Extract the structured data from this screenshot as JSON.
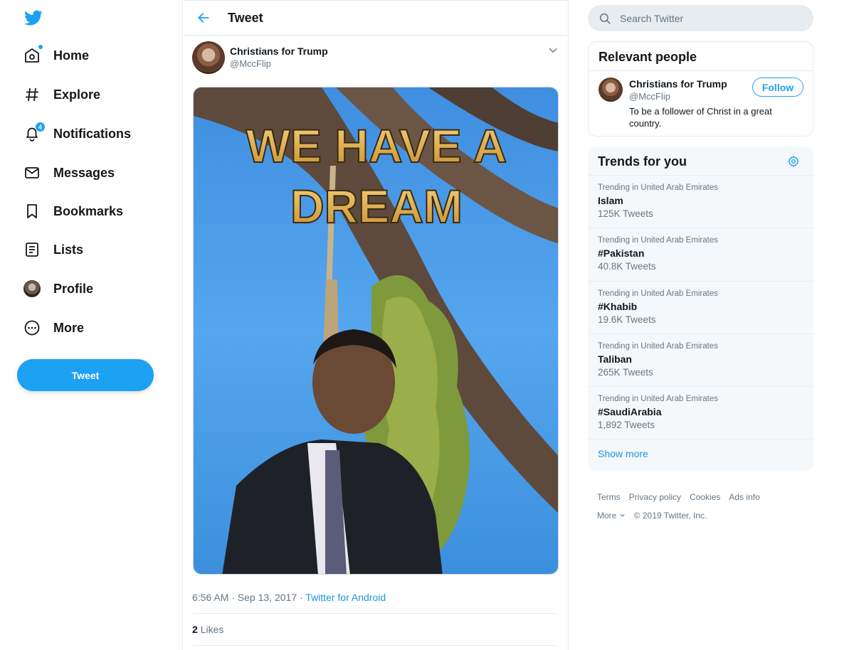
{
  "nav": {
    "items": [
      {
        "label": "Home",
        "icon": "home-icon"
      },
      {
        "label": "Explore",
        "icon": "hashtag-icon"
      },
      {
        "label": "Notifications",
        "icon": "bell-icon",
        "badge": "4"
      },
      {
        "label": "Messages",
        "icon": "envelope-icon"
      },
      {
        "label": "Bookmarks",
        "icon": "bookmark-icon"
      },
      {
        "label": "Lists",
        "icon": "list-icon"
      },
      {
        "label": "Profile",
        "icon": "avatar"
      },
      {
        "label": "More",
        "icon": "more-icon"
      }
    ],
    "tweet_button": "Tweet"
  },
  "tweet": {
    "header_title": "Tweet",
    "author_name": "Christians for Trump",
    "author_handle": "@MccFlip",
    "image_text_line1": "WE HAVE A",
    "image_text_line2": "DREAM",
    "time": "6:56 AM · Sep 13, 2017 · ",
    "via": "Twitter for Android",
    "likes_count": "2",
    "likes_label": "Likes"
  },
  "search": {
    "placeholder": "Search Twitter"
  },
  "relevant": {
    "title": "Relevant people",
    "name": "Christians for Trump",
    "handle": "@MccFlip",
    "bio": "To be a follower of Christ in a great country.",
    "follow_label": "Follow"
  },
  "trends": {
    "title": "Trends for you",
    "items": [
      {
        "context": "Trending in United Arab Emirates",
        "name": "Islam",
        "count": "125K Tweets"
      },
      {
        "context": "Trending in United Arab Emirates",
        "name": "#Pakistan",
        "count": "40.8K Tweets"
      },
      {
        "context": "Trending in United Arab Emirates",
        "name": "#Khabib",
        "count": "19.6K Tweets"
      },
      {
        "context": "Trending in United Arab Emirates",
        "name": "Taliban",
        "count": "265K Tweets"
      },
      {
        "context": "Trending in United Arab Emirates",
        "name": "#SaudiArabia",
        "count": "1,892 Tweets"
      }
    ],
    "show_more": "Show more"
  },
  "footer": {
    "terms": "Terms",
    "privacy": "Privacy policy",
    "cookies": "Cookies",
    "ads": "Ads info",
    "more": "More",
    "copyright": "© 2019 Twitter, Inc."
  },
  "colors": {
    "accent": "#1da1f2",
    "text": "#14171a",
    "muted": "#657786",
    "border": "#e6ecf0"
  }
}
